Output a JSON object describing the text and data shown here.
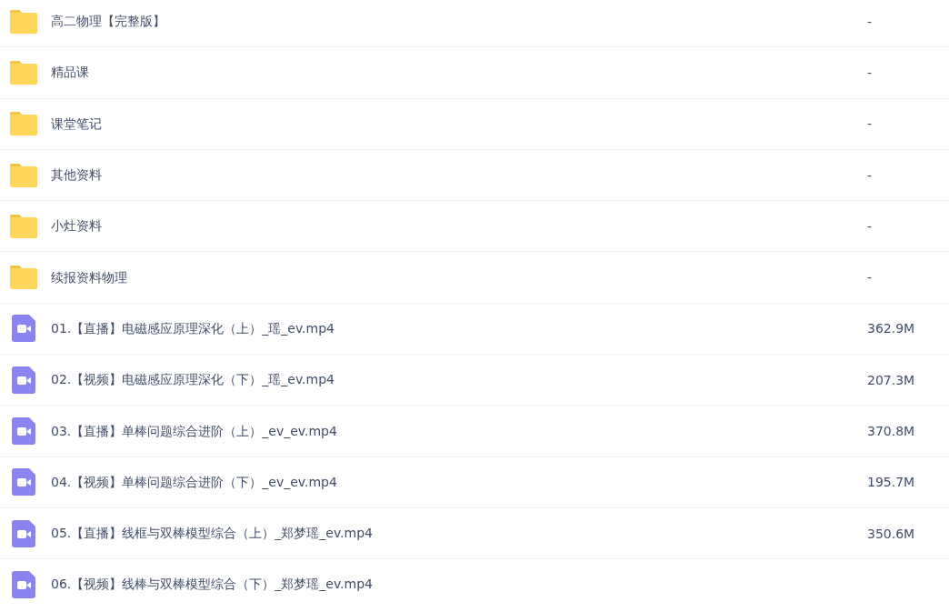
{
  "files": [
    {
      "kind": "folder",
      "name": "高二物理【完整版】",
      "size": "-"
    },
    {
      "kind": "folder",
      "name": "精品课",
      "size": "-"
    },
    {
      "kind": "folder",
      "name": "课堂笔记",
      "size": "-"
    },
    {
      "kind": "folder",
      "name": "其他资料",
      "size": "-"
    },
    {
      "kind": "folder",
      "name": "小灶资料",
      "size": "-"
    },
    {
      "kind": "folder",
      "name": "续报资料物理",
      "size": "-"
    },
    {
      "kind": "video",
      "name": "01.【直播】电磁感应原理深化（上）_瑶_ev.mp4",
      "size": "362.9M"
    },
    {
      "kind": "video",
      "name": "02.【视频】电磁感应原理深化（下）_瑶_ev.mp4",
      "size": "207.3M"
    },
    {
      "kind": "video",
      "name": "03.【直播】单棒问题综合进阶（上）_ev_ev.mp4",
      "size": "370.8M"
    },
    {
      "kind": "video",
      "name": "04.【视频】单棒问题综合进阶（下）_ev_ev.mp4",
      "size": "195.7M"
    },
    {
      "kind": "video",
      "name": "05.【直播】线框与双棒模型综合（上）_郑梦瑶_ev.mp4",
      "size": "350.6M"
    },
    {
      "kind": "video",
      "name": "06.【视频】线棒与双棒模型综合（下）_郑梦瑶_ev.mp4"
    }
  ]
}
